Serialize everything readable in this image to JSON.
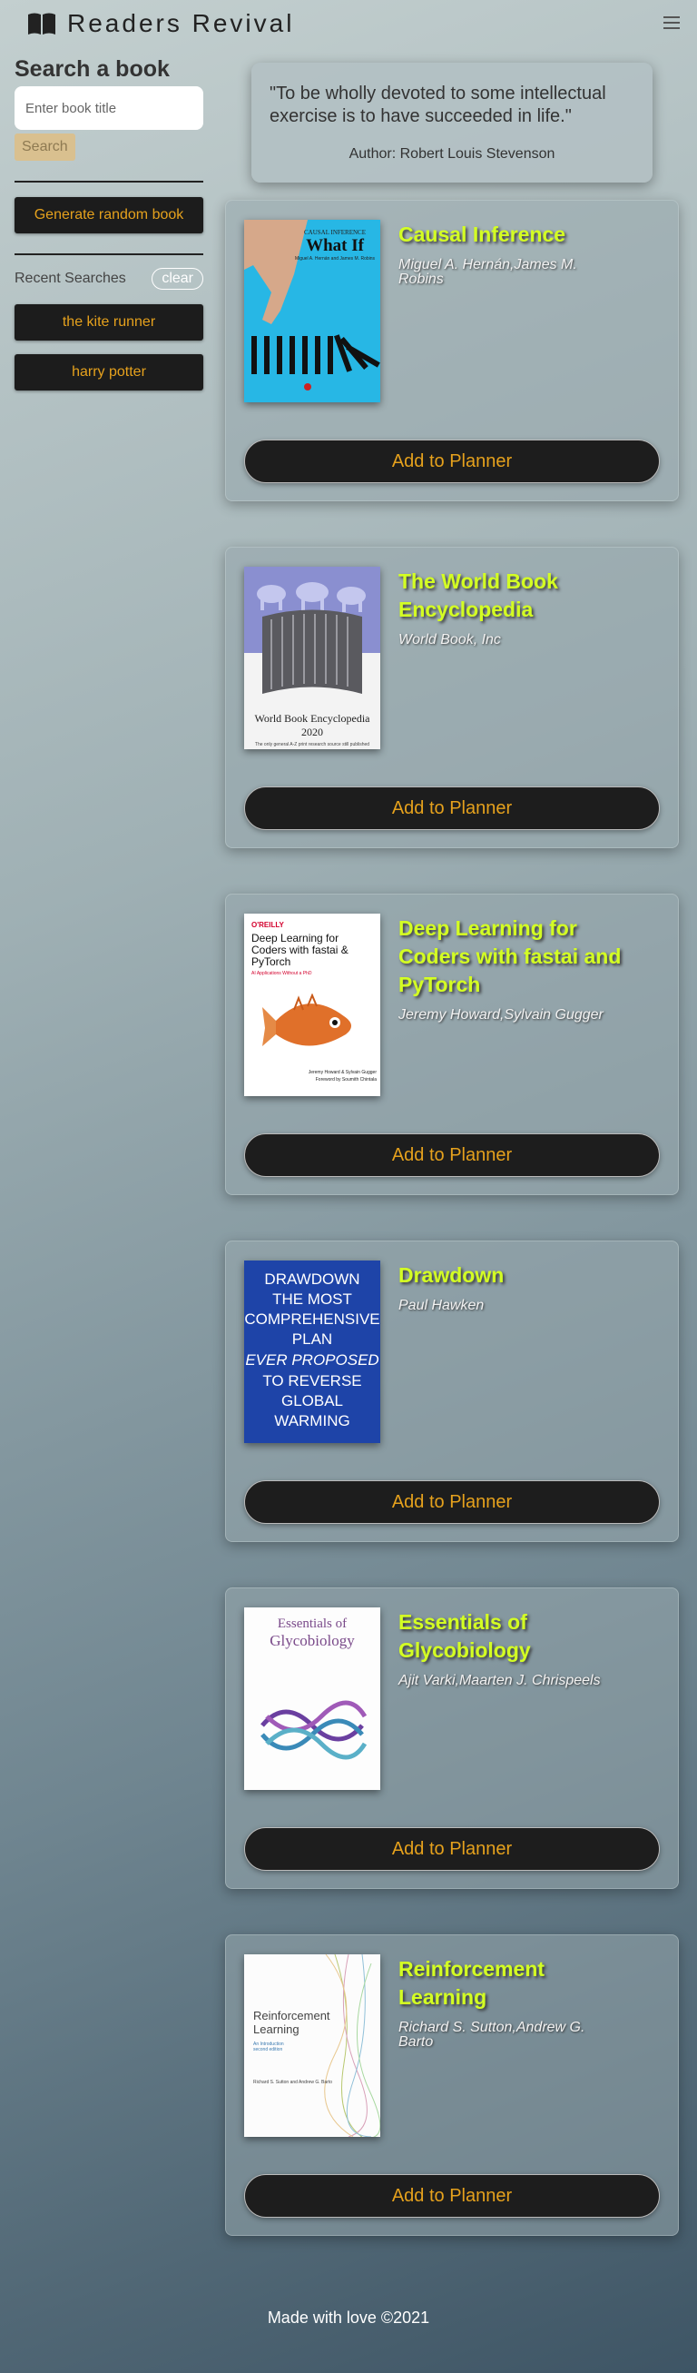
{
  "header": {
    "brand": "Readers Revival",
    "logo_icon": "open-book-icon",
    "menu_icon": "hamburger-menu-icon"
  },
  "sidebar": {
    "search_title": "Search a book",
    "search_placeholder": "Enter book title",
    "search_value": "",
    "search_button": "Search",
    "random_button": "Generate random book",
    "recent_title": "Recent Searches",
    "clear_button": "clear",
    "recent": [
      "the kite runner",
      "harry potter"
    ]
  },
  "quote": {
    "text": "\"To be wholly devoted to some intellectual exercise is to have succeeded in life.\"",
    "author": "Author: Robert Louis Stevenson"
  },
  "books": [
    {
      "title": "Causal Inference",
      "authors": "Miguel A. Hernán,James M. Robins",
      "button": "Add to Planner",
      "cover_text": [
        "CAUSAL INFERENCE",
        "What If",
        "Miguel A. Hernán and James M. Robins"
      ]
    },
    {
      "title": "The World Book Encyclopedia",
      "authors": "World Book, Inc",
      "button": "Add to Planner",
      "cover_text": [
        "World Book Encyclopedia 2020",
        "The only general A-Z print research source still published"
      ]
    },
    {
      "title": "Deep Learning for Coders with fastai and PyTorch",
      "authors": "Jeremy Howard,Sylvain Gugger",
      "button": "Add to Planner",
      "cover_text": [
        "O'REILLY",
        "Deep Learning for Coders with fastai & PyTorch",
        "AI Applications Without a PhD",
        "Jeremy Howard & Sylvain Gugger",
        "Foreword by Soumith Chintala"
      ]
    },
    {
      "title": "Drawdown",
      "authors": "Paul Hawken",
      "button": "Add to Planner",
      "cover_text": [
        "DRAWDOWN",
        "THE MOST",
        "COMPREHENSIVE",
        "PLAN",
        "EVER PROPOSED",
        "TO REVERSE",
        "GLOBAL WARMING"
      ]
    },
    {
      "title": "Essentials of Glycobiology",
      "authors": "Ajit Varki,Maarten J. Chrispeels",
      "button": "Add to Planner",
      "cover_text": [
        "Essentials of",
        "Glycobiology"
      ]
    },
    {
      "title": "Reinforcement Learning",
      "authors": "Richard S. Sutton,Andrew G. Barto",
      "button": "Add to Planner",
      "cover_text": [
        "Reinforcement",
        "Learning",
        "An Introduction",
        "second edition",
        "Richard S. Sutton and Andrew G. Barto"
      ]
    }
  ],
  "footer": {
    "text": "Made with love ©2021"
  },
  "colors": {
    "title": "#d4ff23",
    "accent": "#e5a11d",
    "button_bg": "#1d1d1d"
  }
}
